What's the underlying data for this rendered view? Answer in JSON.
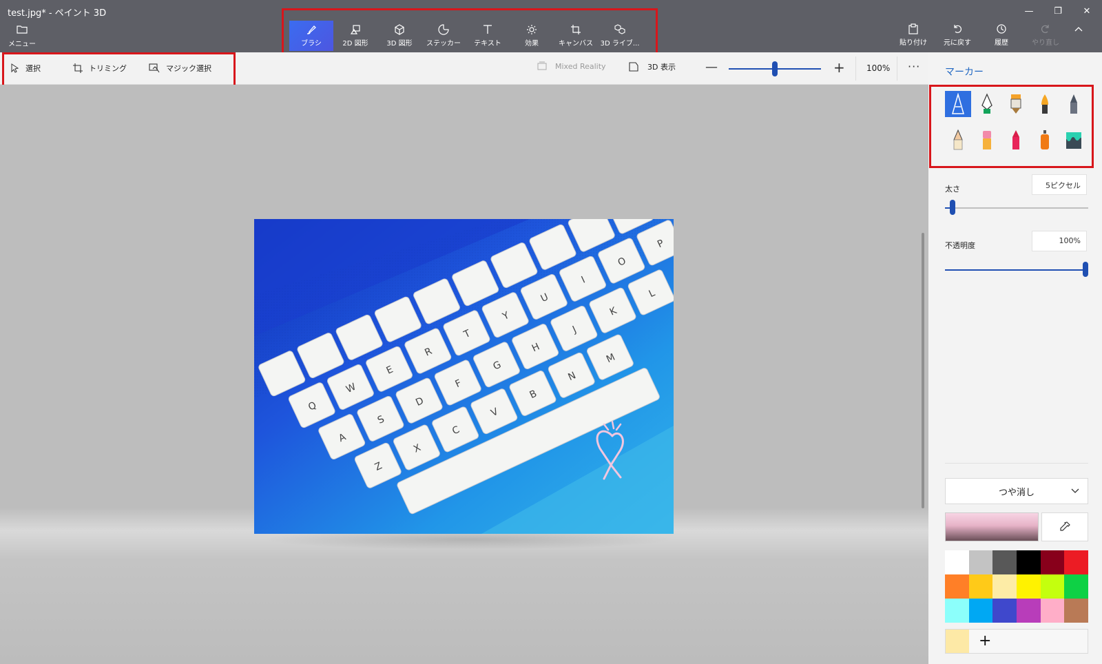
{
  "window": {
    "title": "test.jpg* - ペイント 3D",
    "controls": {
      "minimize": "—",
      "restore": "❐",
      "close": "✕"
    }
  },
  "ribbon": {
    "menu_label": "メニュー",
    "tools": [
      {
        "label": "ブラシ",
        "icon": "brush-icon",
        "active": true
      },
      {
        "label": "2D 図形",
        "icon": "2d-shapes-icon"
      },
      {
        "label": "3D 図形",
        "icon": "3d-shapes-icon"
      },
      {
        "label": "ステッカー",
        "icon": "sticker-icon"
      },
      {
        "label": "テキスト",
        "icon": "text-icon"
      },
      {
        "label": "効果",
        "icon": "effects-icon"
      },
      {
        "label": "キャンバス",
        "icon": "canvas-icon"
      },
      {
        "label": "3D ライブ...",
        "icon": "3d-library-icon"
      }
    ],
    "actions": [
      {
        "label": "貼り付け",
        "icon": "paste-icon"
      },
      {
        "label": "元に戻す",
        "icon": "undo-icon"
      },
      {
        "label": "履歴",
        "icon": "history-icon"
      },
      {
        "label": "やり直し",
        "icon": "redo-icon",
        "disabled": true
      }
    ],
    "collapse_icon": "chevron-up-icon"
  },
  "subbar": {
    "select": "選択",
    "crop": "トリミング",
    "magic_select": "マジック選択",
    "mixed_reality": "Mixed Reality",
    "view_3d": "3D 表示",
    "zoom_minus": "—",
    "zoom_plus": "+",
    "zoom_value": "100%",
    "more": "···"
  },
  "panel": {
    "title": "マーカー",
    "brushes": [
      "marker-icon",
      "calligraphy-pen-icon",
      "oil-brush-icon",
      "watercolor-icon",
      "pixel-pen-icon",
      "pencil-icon",
      "eraser-icon",
      "crayon-icon",
      "spray-can-icon",
      "fill-icon"
    ],
    "thickness_label": "太さ",
    "thickness_value": "5ピクセル",
    "thickness_level": 0.03,
    "opacity_label": "不透明度",
    "opacity_value": "100%",
    "opacity_level": 1.0,
    "finish": "つや消し",
    "current_color": "#e7b3c8",
    "palette": [
      "#ffffff",
      "#c3c3c3",
      "#585858",
      "#000000",
      "#88001b",
      "#ec1c24",
      "#ff7f27",
      "#ffca18",
      "#fdeca6",
      "#fff200",
      "#c4ff0e",
      "#0ed145",
      "#8cfffb",
      "#00a8f3",
      "#3f48cc",
      "#b83dba",
      "#ffaec8",
      "#b97a56"
    ],
    "custom_swatch": "#fde9a6",
    "add_label": "+"
  },
  "canvas": {
    "image_description_keys": [
      "Q",
      "W",
      "E",
      "R",
      "T",
      "Y",
      "U",
      "I",
      "O",
      "P",
      "A",
      "S",
      "D",
      "F",
      "G",
      "H",
      "J",
      "K",
      "L",
      "Z",
      "X",
      "C",
      "V",
      "B",
      "N",
      "M"
    ]
  }
}
